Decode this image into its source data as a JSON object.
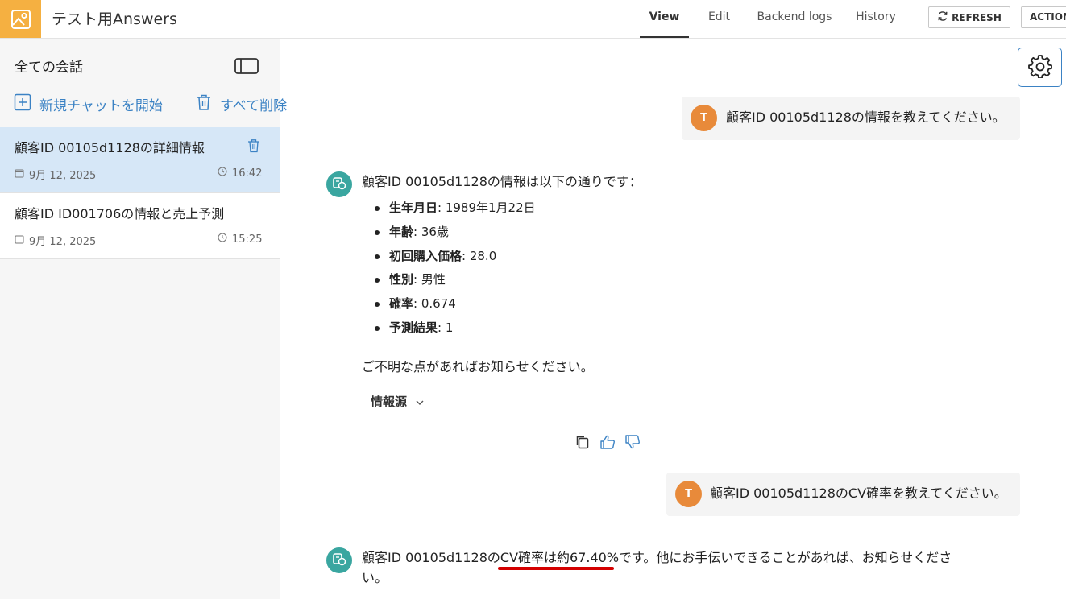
{
  "app": {
    "title": "テスト用Answers"
  },
  "tabs": [
    {
      "label": "View",
      "active": true
    },
    {
      "label": "Edit"
    },
    {
      "label": "Backend logs"
    },
    {
      "label": "History"
    }
  ],
  "toolbar": {
    "refresh_label": "REFRESH",
    "actions_label": "ACTIONS"
  },
  "sidebar": {
    "title": "全ての会話",
    "new_chat_label": "新規チャットを開始",
    "delete_all_label": "すべて削除",
    "conversations": [
      {
        "title": "顧客ID 00105d1128の詳細情報",
        "date": "9月 12, 2025",
        "time": "16:42",
        "active": true
      },
      {
        "title": "顧客ID ID001706の情報と売上予測",
        "date": "9月 12, 2025",
        "time": "15:25",
        "active": false
      }
    ]
  },
  "chat": {
    "messages": [
      {
        "role": "user",
        "avatar": "T",
        "text": "顧客ID 00105d1128の情報を教えてください。"
      },
      {
        "role": "assistant",
        "intro": "顧客ID 00105d1128の情報は以下の通りです：",
        "items": [
          {
            "label": "生年月日",
            "value": ": 1989年1月22日"
          },
          {
            "label": "年齢",
            "value": ": 36歳"
          },
          {
            "label": "初回購入価格",
            "value": ": 28.0"
          },
          {
            "label": "性別",
            "value": ": 男性"
          },
          {
            "label": "確率",
            "value": ": 0.674"
          },
          {
            "label": "予測結果",
            "value": ": 1"
          }
        ],
        "outro": "ご不明な点があればお知らせください。",
        "sources_label": "情報源"
      },
      {
        "role": "user",
        "avatar": "T",
        "text": "顧客ID 00105d1128のCV確率を教えてください。"
      },
      {
        "role": "assistant",
        "line1": "顧客ID 00105d1128のCV確率は約67.40%です。他にお手伝いできることがあれば、お知らせくださ",
        "line2": "い。"
      }
    ]
  },
  "colors": {
    "accent": "#3b82c4",
    "logo": "#f5b041",
    "user_avatar": "#e88a3a",
    "bot_avatar": "#3aa6a0",
    "active_conversation": "#d6e7f7",
    "highlight_underline": "#d40000"
  },
  "icons": [
    "image-logo-icon",
    "refresh-icon",
    "sidebar-collapse-icon",
    "plus-square-icon",
    "trash-icon",
    "calendar-icon",
    "clock-icon",
    "settings-gear-icon",
    "bot-icon",
    "chevron-down-icon",
    "copy-icon",
    "thumbs-up-icon",
    "thumbs-down-icon"
  ]
}
